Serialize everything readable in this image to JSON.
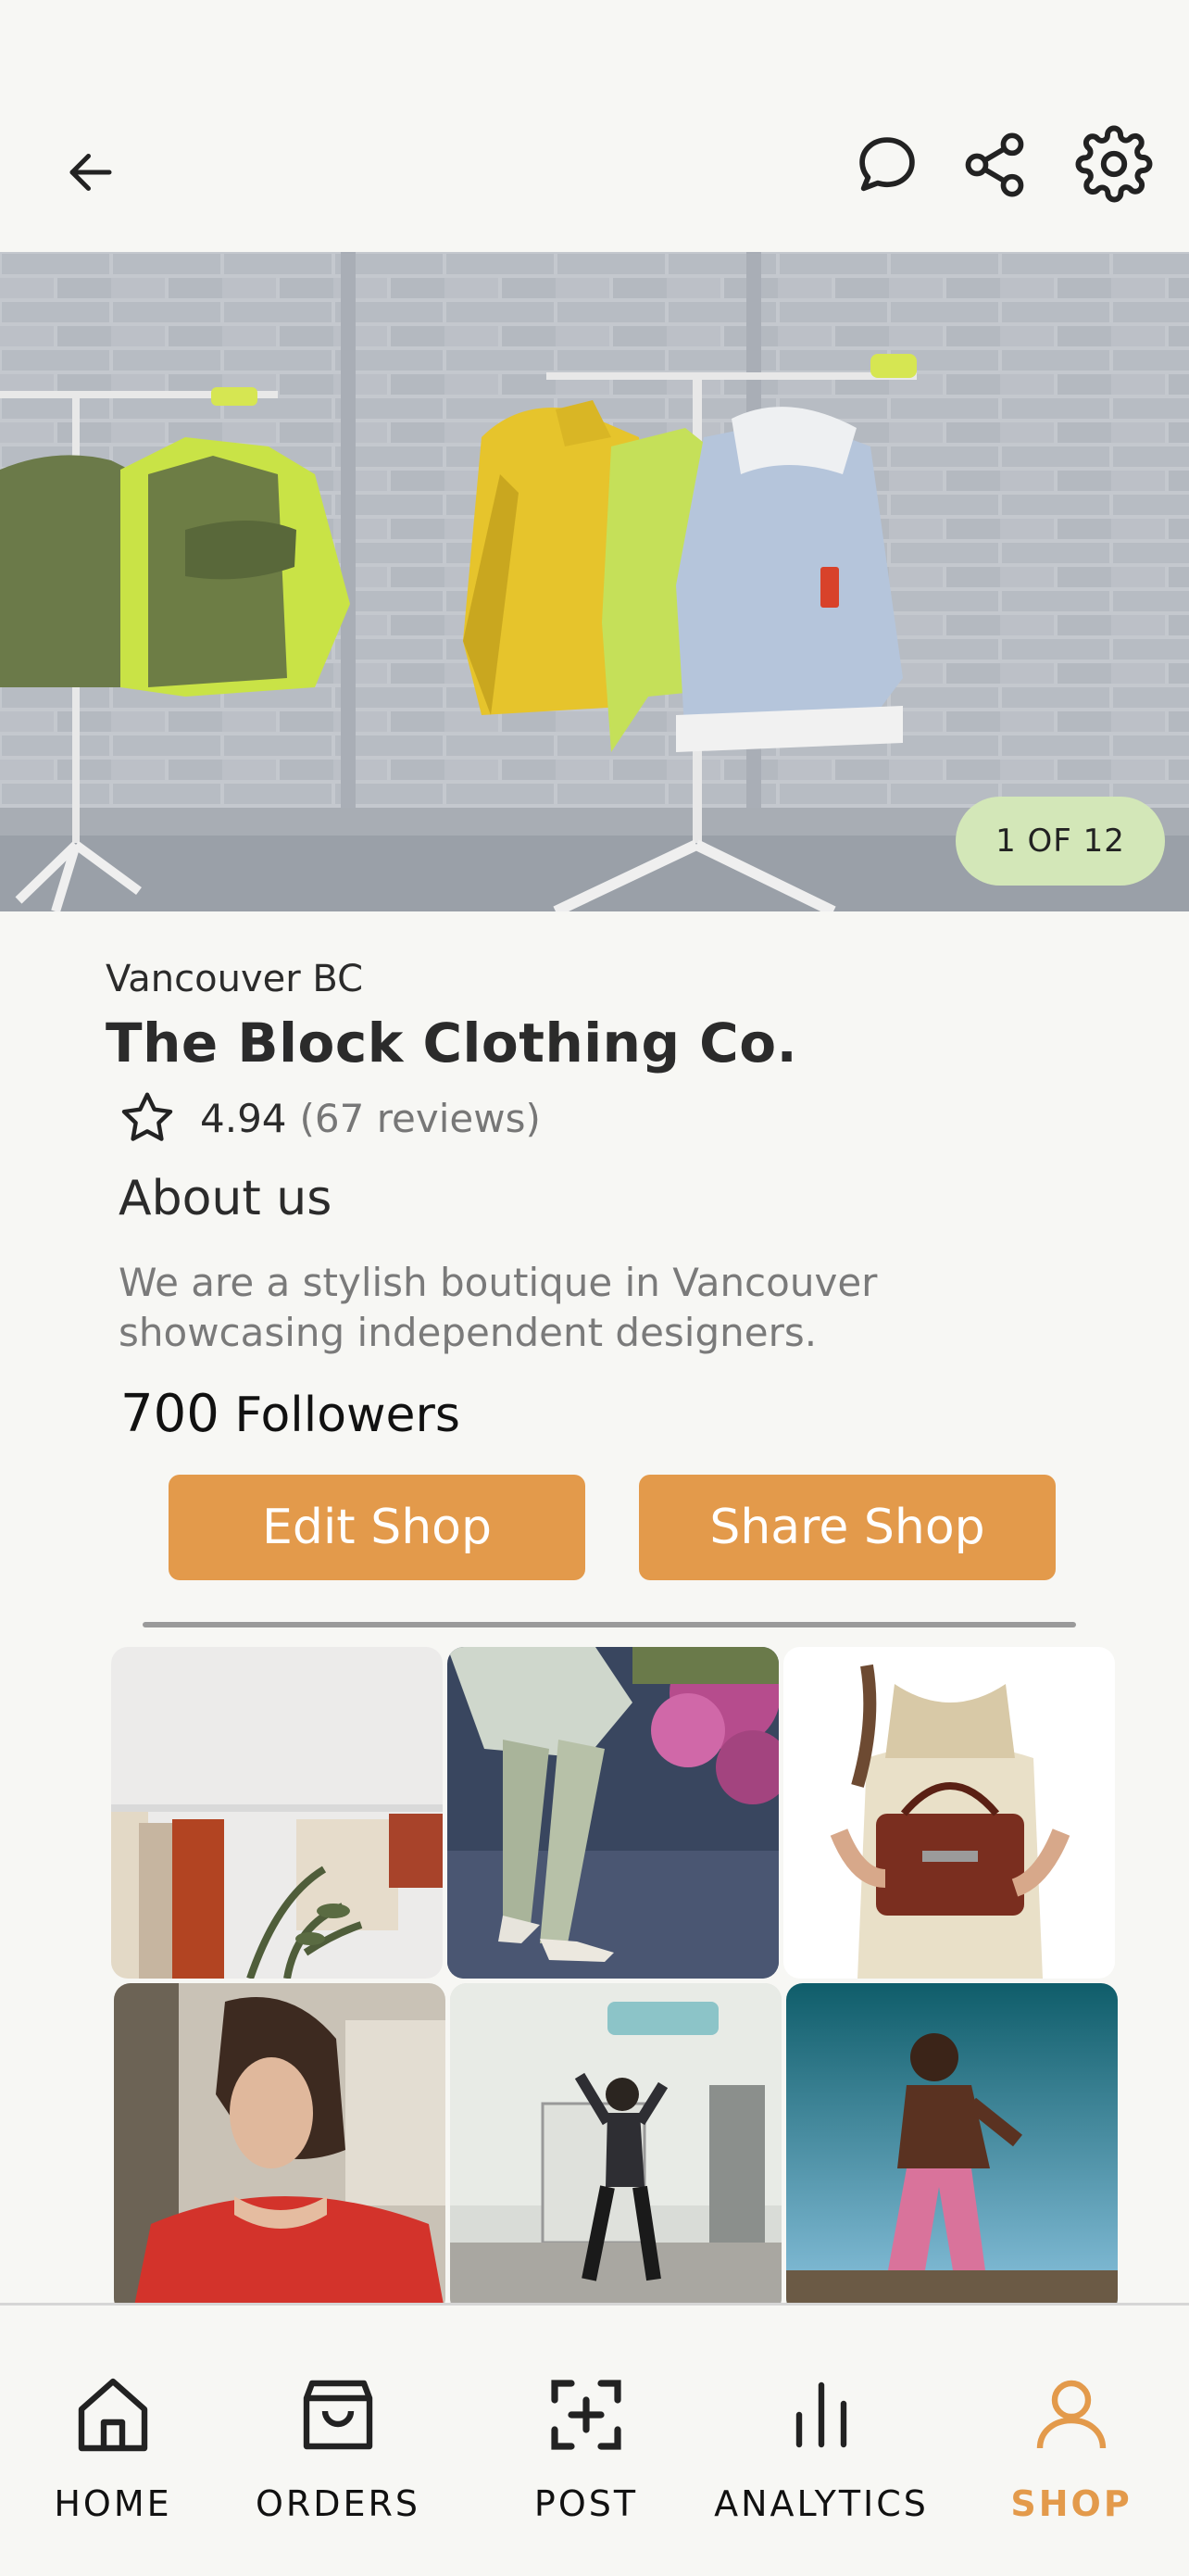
{
  "header": {
    "back_icon": "arrow-left-icon",
    "chat_icon": "chat-bubble-icon",
    "share_icon": "share-icon",
    "settings_icon": "gear-icon"
  },
  "hero": {
    "counter": "1 OF 12"
  },
  "shop": {
    "location": "Vancouver BC",
    "name": "The Block Clothing Co.",
    "rating": "4.94",
    "reviews": "(67 reviews)",
    "about_title": "About us",
    "about_text": "We are a stylish boutique in Vancouver showcasing independent designers.",
    "followers_count": "700",
    "followers_label": "Followers"
  },
  "actions": {
    "edit_label": "Edit Shop",
    "share_label": "Share Shop"
  },
  "nav": {
    "items": [
      {
        "label": "HOME",
        "icon": "home-icon"
      },
      {
        "label": "ORDERS",
        "icon": "shopping-bag-icon"
      },
      {
        "label": "POST",
        "icon": "add-post-icon"
      },
      {
        "label": "ANALYTICS",
        "icon": "bar-chart-icon"
      },
      {
        "label": "SHOP",
        "icon": "person-icon"
      }
    ],
    "active": "SHOP"
  },
  "colors": {
    "accent": "#e39a4b",
    "counter_bg": "#d3e7b8",
    "background": "#f7f7f4"
  }
}
